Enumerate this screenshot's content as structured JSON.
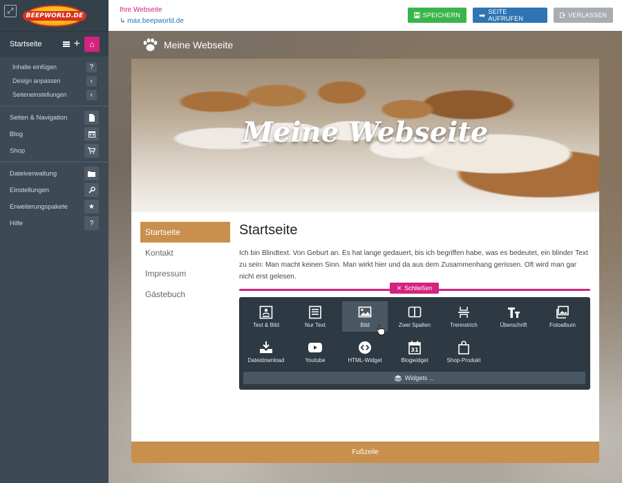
{
  "sidebar": {
    "home_title": "Startseite",
    "sub_items": [
      {
        "label": "Inhalte einfügen",
        "icon": "?"
      },
      {
        "label": "Design anpassen",
        "icon": "‹"
      },
      {
        "label": "Seiteneinstellungen",
        "icon": "‹"
      }
    ],
    "group1": [
      {
        "label": "Seiten & Navigation",
        "icon": "pages-icon"
      },
      {
        "label": "Blog",
        "icon": "calendar-icon"
      },
      {
        "label": "Shop",
        "icon": "cart-icon"
      }
    ],
    "group2": [
      {
        "label": "Dateiverwaltung",
        "icon": "folder-icon"
      },
      {
        "label": "Einstellungen",
        "icon": "wrench-icon"
      },
      {
        "label": "Erweiterungspakete",
        "icon": "star-icon"
      },
      {
        "label": "Hilfe",
        "icon": "?"
      }
    ],
    "logo_text": "BEEPWORLD.DE"
  },
  "topbar": {
    "site_label": "Ihre Webseite",
    "site_url": "max.beepworld.de",
    "save_label": "SPEICHERN",
    "view_label": "SEITE AUFRUFEN",
    "exit_label": "VERLASSEN"
  },
  "page": {
    "title": "Meine Webseite",
    "hero_title": "Meine Webseite",
    "nav": [
      "Startseite",
      "Kontakt",
      "Impressum",
      "Gästebuch"
    ],
    "heading": "Startseite",
    "body": "Ich bin Blindtext. Von Geburt an. Es hat lange gedauert, bis ich begriffen habe, was es bedeutet, ein blinder Text zu sein: Man macht keinen Sinn. Man wirkt hier und da aus dem Zusammenhang gerissen. Oft wird man gar nicht erst gelesen.",
    "footer": "Fußzeile"
  },
  "insert": {
    "close_label": "Schließen",
    "widgets_label": "Widgets ...",
    "tiles": [
      {
        "label": "Text & Bild",
        "icon": "text-image-icon"
      },
      {
        "label": "Nur Text",
        "icon": "text-only-icon"
      },
      {
        "label": "Bild",
        "icon": "image-icon"
      },
      {
        "label": "Zwei Spalten",
        "icon": "two-columns-icon"
      },
      {
        "label": "Trennstrich",
        "icon": "separator-icon"
      },
      {
        "label": "Überschrift",
        "icon": "heading-icon"
      },
      {
        "label": "Fotoalbum",
        "icon": "photo-album-icon"
      },
      {
        "label": "Dateidownload",
        "icon": "download-icon"
      },
      {
        "label": "Youtube",
        "icon": "youtube-icon"
      },
      {
        "label": "HTML-Widget",
        "icon": "html-widget-icon"
      },
      {
        "label": "Blogwidget",
        "icon": "blog-widget-icon"
      },
      {
        "label": "Shop-Produkt",
        "icon": "shop-product-icon"
      }
    ]
  },
  "colors": {
    "accent": "#d3237f",
    "nav_active": "#c98f4c",
    "save": "#3bb54a",
    "view": "#2f74b3",
    "exit": "#a9adb1",
    "sidebar": "#3d4a55",
    "panel": "#2e3a43"
  }
}
